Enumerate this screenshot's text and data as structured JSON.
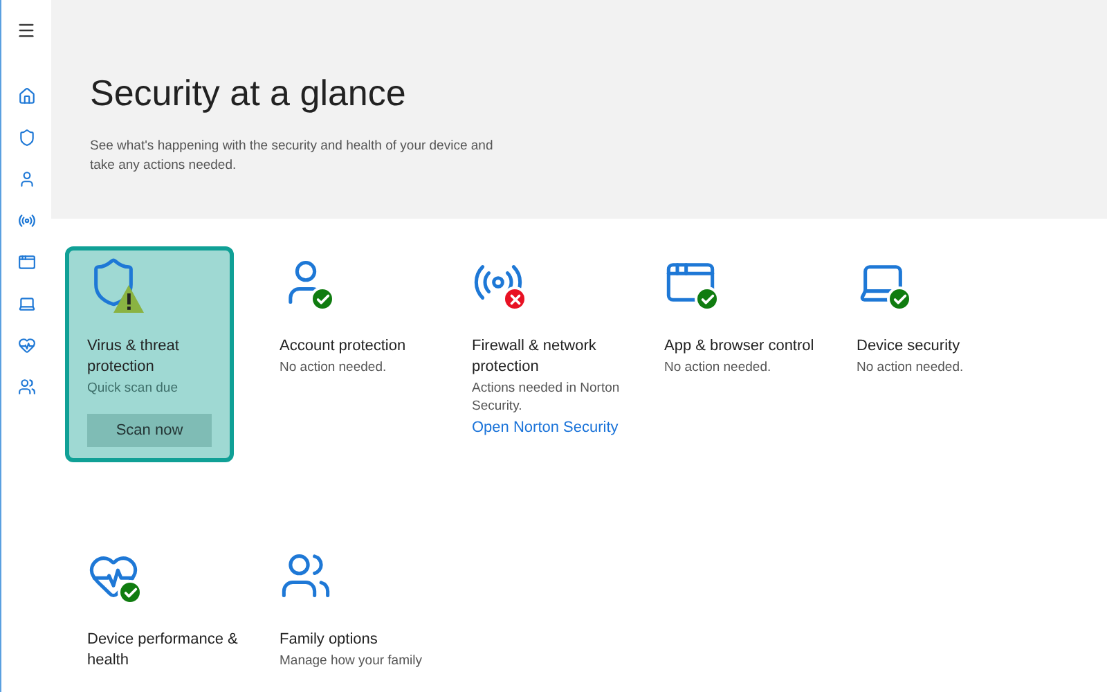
{
  "sidebar": {
    "items": [
      {
        "kind": "menu"
      },
      {
        "kind": "home"
      },
      {
        "kind": "shield"
      },
      {
        "kind": "person"
      },
      {
        "kind": "wifi"
      },
      {
        "kind": "browser"
      },
      {
        "kind": "laptop"
      },
      {
        "kind": "heart"
      },
      {
        "kind": "family"
      }
    ]
  },
  "header": {
    "title": "Security at a glance",
    "subtitle": "See what's happening with the security and health of your device and take any actions needed."
  },
  "tiles": [
    {
      "kind": "shield",
      "badge": {
        "kind": "warning"
      },
      "selected": true,
      "title": "Virus & threat protection",
      "detail": "Quick scan due",
      "button": "Scan now"
    },
    {
      "kind": "person",
      "badge": {
        "kind": "ok"
      },
      "selected": false,
      "title": "Account protection",
      "detail": "No action needed."
    },
    {
      "kind": "wifi",
      "badge": {
        "kind": "error"
      },
      "selected": false,
      "title": "Firewall & network protection",
      "detail": "Actions needed in Norton Security.",
      "link": "Open Norton Security"
    },
    {
      "kind": "browser",
      "badge": {
        "kind": "ok"
      },
      "selected": false,
      "title": "App & browser control",
      "detail": "No action needed."
    },
    {
      "kind": "laptop",
      "badge": {
        "kind": "ok"
      },
      "selected": false,
      "title": "Device security",
      "detail": "No action needed."
    },
    {
      "kind": "heart",
      "badge": {
        "kind": "ok"
      },
      "selected": false,
      "title": "Device performance & health"
    },
    {
      "kind": "family",
      "selected": false,
      "title": "Family options",
      "detail": "Manage how your family"
    }
  ]
}
